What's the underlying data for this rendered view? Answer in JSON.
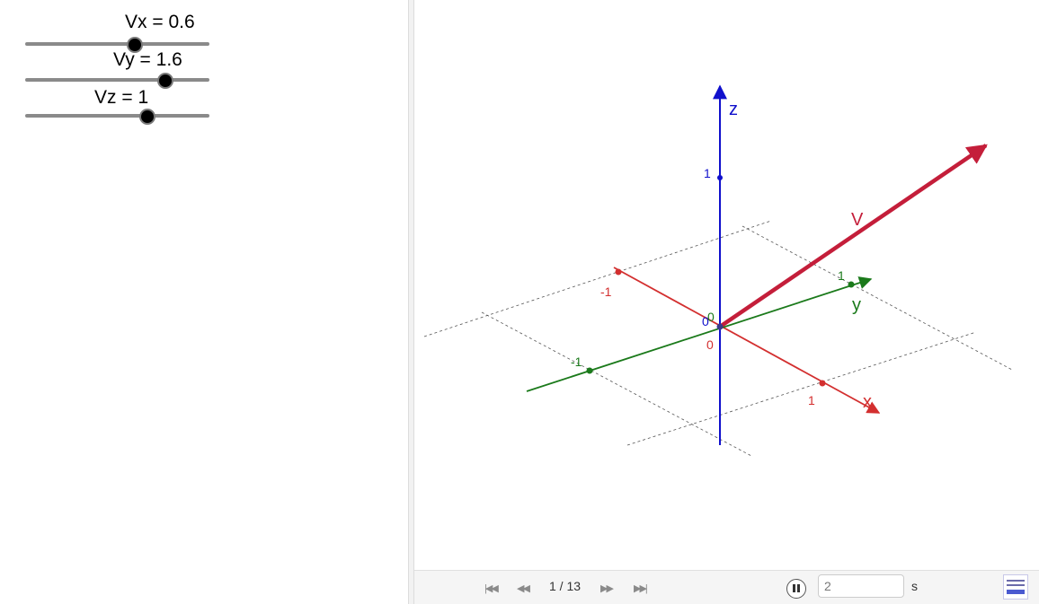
{
  "sliders": [
    {
      "label": "Vx = 0.6",
      "value": 0.6
    },
    {
      "label": "Vy = 1.6",
      "value": 1.6
    },
    {
      "label": "Vz = 1",
      "value": 1
    }
  ],
  "view3d": {
    "axis_labels": {
      "x": "x",
      "y": "y",
      "z": "z"
    },
    "tick_labels": {
      "x_neg": "-1",
      "x_pos": "1",
      "y_neg": "-1",
      "y_pos": "1",
      "z_pos": "1"
    },
    "origin_labels": [
      "0",
      "0",
      "0"
    ],
    "vector_label": "V",
    "colors": {
      "x": "#d32f2f",
      "y": "#1b7a1b",
      "z": "#1010cc",
      "vector": "#c41e3a",
      "grid": "#555555"
    }
  },
  "toolbar": {
    "first_icon": "skip-to-start-icon",
    "prev_icon": "step-back-icon",
    "frame_counter": "1 / 13",
    "next_icon": "step-forward-icon",
    "last_icon": "skip-to-end-icon",
    "pause_icon": "pause-icon",
    "speed_value": "2",
    "unit": "s",
    "algebra_icon": "algebra-view-icon"
  }
}
